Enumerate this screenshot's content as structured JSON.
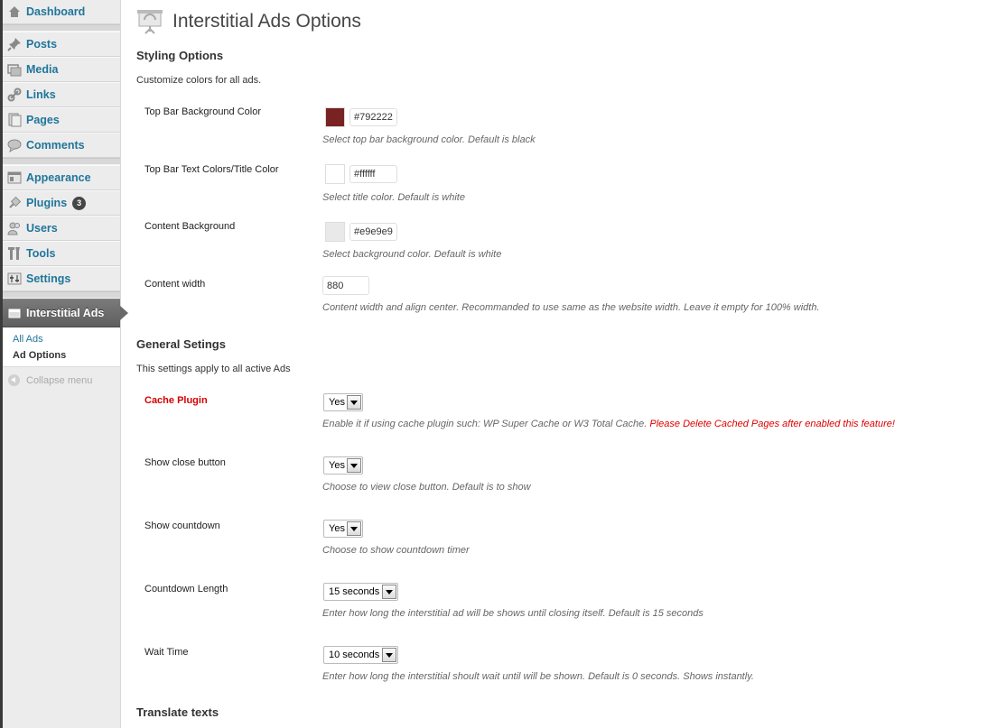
{
  "sidebar": {
    "items": [
      {
        "label": "Dashboard",
        "icon": "dashboard-icon"
      },
      {
        "label": "Posts",
        "icon": "posts-pin-icon"
      },
      {
        "label": "Media",
        "icon": "media-icon"
      },
      {
        "label": "Links",
        "icon": "links-icon"
      },
      {
        "label": "Pages",
        "icon": "pages-icon"
      },
      {
        "label": "Comments",
        "icon": "comments-icon"
      },
      {
        "label": "Appearance",
        "icon": "appearance-icon"
      },
      {
        "label": "Plugins",
        "icon": "plugins-icon",
        "badge": "3"
      },
      {
        "label": "Users",
        "icon": "users-icon"
      },
      {
        "label": "Tools",
        "icon": "tools-icon"
      },
      {
        "label": "Settings",
        "icon": "settings-icon"
      }
    ],
    "active": {
      "label": "Interstitial Ads",
      "icon": "interstitial-ads-icon"
    },
    "submenu": [
      {
        "label": "All Ads",
        "current": false
      },
      {
        "label": "Ad Options",
        "current": true
      }
    ],
    "collapse_label": "Collapse menu"
  },
  "page": {
    "title": "Interstitial Ads Options",
    "styling": {
      "title": "Styling Options",
      "desc": "Customize colors for all ads.",
      "top_bar_bg": {
        "label": "Top Bar Background Color",
        "value": "#792222",
        "color": "#792222",
        "desc": "Select top bar background color. Default is black"
      },
      "top_bar_text": {
        "label": "Top Bar Text Colors/Title Color",
        "value": "#ffffff",
        "color": "#ffffff",
        "desc": "Select title color. Default is white"
      },
      "content_bg": {
        "label": "Content Background",
        "value": "#e9e9e9",
        "color": "#e9e9e9",
        "desc": "Select background color. Default is white"
      },
      "content_width": {
        "label": "Content width",
        "value": "880",
        "desc": "Content width and align center. Recommanded to use same as the website width. Leave it empty for 100% width."
      }
    },
    "general": {
      "title": "General Setings",
      "desc": "This settings apply to all active Ads",
      "cache_plugin": {
        "label": "Cache Plugin",
        "value": "Yes",
        "desc": "Enable it if using cache plugin such: WP Super Cache or W3 Total Cache. ",
        "warning": "Please Delete Cached Pages after enabled this feature!"
      },
      "close_button": {
        "label": "Show close button",
        "value": "Yes",
        "desc": "Choose to view close button. Default is to show"
      },
      "countdown": {
        "label": "Show countdown",
        "value": "Yes",
        "desc": "Choose to show countdown timer"
      },
      "countdown_length": {
        "label": "Countdown Length",
        "value": "15 seconds",
        "desc": "Enter how long the interstitial ad will be shows until closing itself. Default is 15 seconds"
      },
      "wait_time": {
        "label": "Wait Time",
        "value": "10 seconds",
        "desc": "Enter how long the interstitial shoult wait until will be shown. Default is 0 seconds. Shows instantly."
      }
    },
    "translate": {
      "title": "Translate texts"
    }
  }
}
